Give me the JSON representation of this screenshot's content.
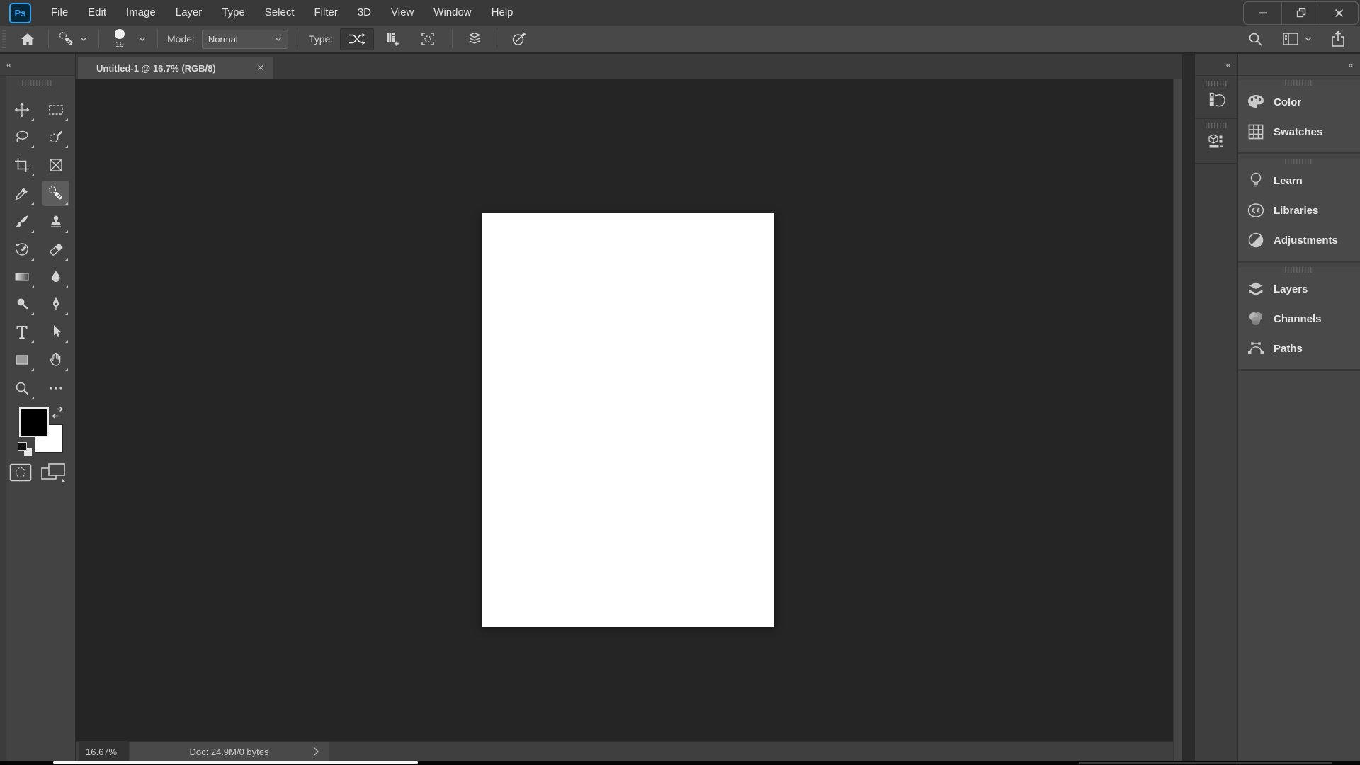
{
  "titlebar": {
    "logo_text": "Ps",
    "menus": [
      "File",
      "Edit",
      "Image",
      "Layer",
      "Type",
      "Select",
      "Filter",
      "3D",
      "View",
      "Window",
      "Help"
    ],
    "window_controls": [
      "minimize",
      "restore",
      "close"
    ]
  },
  "options_bar": {
    "left_icons": [
      "home",
      "spot-healing-brush-preset",
      "brush-size"
    ],
    "brush_size": "19",
    "mode_label": "Mode:",
    "mode_value": "Normal",
    "type_label": "Type:",
    "type_buttons": [
      "content-aware",
      "create-texture",
      "proximity-match"
    ],
    "type_selected": "content-aware",
    "toggle_icons": [
      "sample-all-layers",
      "pen-pressure"
    ],
    "right_icons": [
      "search",
      "workspace-switcher",
      "share"
    ]
  },
  "document_tab": {
    "title": "Untitled-1 @ 16.7% (RGB/8)",
    "close_glyph": "×"
  },
  "tool_panel": {
    "collapse_glyph": "«",
    "tools": [
      "move",
      "rectangular-marquee",
      "lasso",
      "quick-selection",
      "crop",
      "frame",
      "eyedropper",
      "spot-healing-brush",
      "brush",
      "clone-stamp",
      "history-brush",
      "eraser",
      "gradient",
      "blur",
      "dodge",
      "pen",
      "type",
      "path-selection",
      "rectangle",
      "hand",
      "zoom",
      "more-tools"
    ],
    "selected_tool": "spot-healing-brush",
    "foreground_color": "#000000",
    "background_color": "#ffffff"
  },
  "canvas": {
    "document_color": "#ffffff"
  },
  "right_dock": {
    "collapse_glyph": "«",
    "collapsed_panels": [
      "history",
      "properties"
    ],
    "groups": [
      {
        "items": [
          {
            "label": "Color",
            "icon": "color-palette"
          },
          {
            "label": "Swatches",
            "icon": "swatches-grid"
          }
        ]
      },
      {
        "items": [
          {
            "label": "Learn",
            "icon": "lightbulb"
          },
          {
            "label": "Libraries",
            "icon": "creative-cloud"
          },
          {
            "label": "Adjustments",
            "icon": "adjustments-circle"
          }
        ]
      },
      {
        "items": [
          {
            "label": "Layers",
            "icon": "layers-stack"
          },
          {
            "label": "Channels",
            "icon": "channels-circles"
          },
          {
            "label": "Paths",
            "icon": "bezier-path"
          }
        ]
      }
    ]
  },
  "status_bar": {
    "zoom_level": "16.67%",
    "doc_info": "Doc: 24.9M/0 bytes"
  },
  "colors": {
    "titlebar_bg": "#393939",
    "options_bar_bg": "#484848",
    "dock_bg": "#434343",
    "canvas_bg": "#252525",
    "accent_blue": "#2ea3f2"
  }
}
